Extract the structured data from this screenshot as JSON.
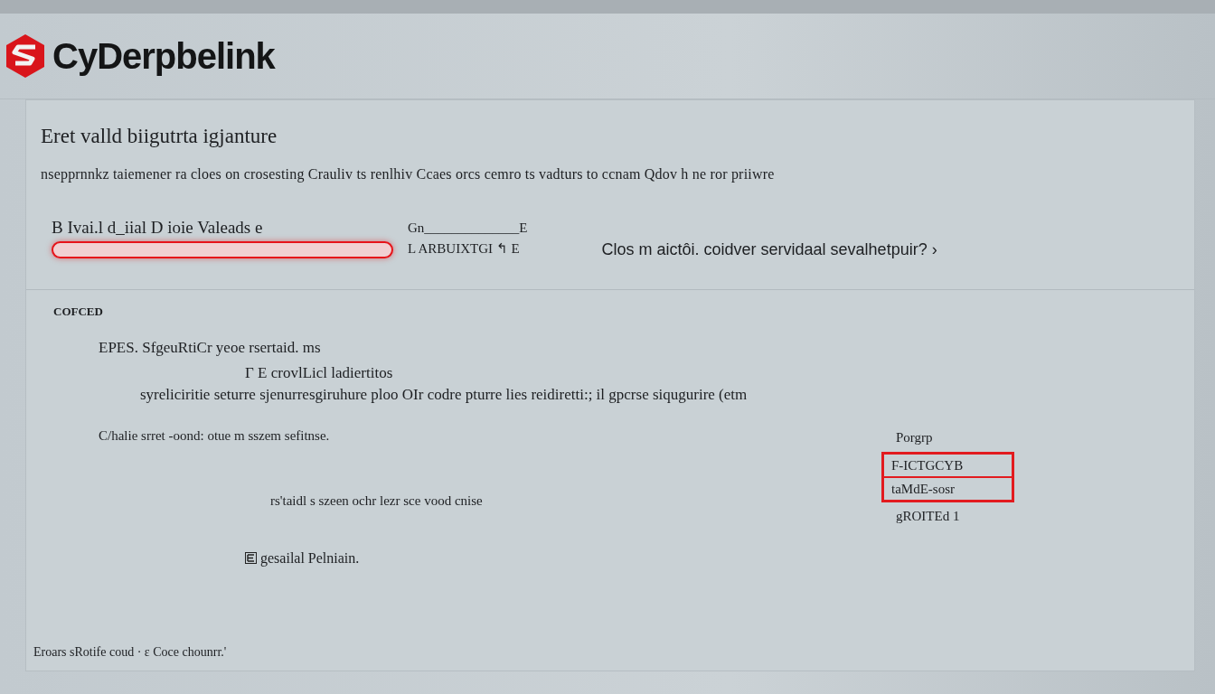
{
  "brand": {
    "name": "CyDerpbelink"
  },
  "heading": "Eret valld biigutrta igjanture",
  "description": "nsepprnnkz taiemener ra cloes on crosesting Crauliv ts renlhiv Ccaes orcs cemro ts vadturs to ccnam Qdov h ne ror priiwre",
  "field": {
    "label": "B Ivai.l d_iial D ioie Valeads e",
    "invalid": true
  },
  "side_labels": [
    "Gn______________E",
    "L ARBUIXTGI ↰ E"
  ],
  "question": "Clos m aictôi. coidver servidaal sevalhetpuir? ›",
  "section": {
    "title": "COFCED",
    "lines": [
      "EPES. SfgeuRtiCr yeoe rsertaid. ms",
      "Г E crovlLicl ladiertitos",
      "syreliciritie seturre sjenurresgiruhure ploo OIr codre pturre lies reidiretti:; il gpcrse siqugurire (etm"
    ],
    "note": "C/halie srret -oond: otue m sszem sefitnse.",
    "sub_note": "rs'taidl s szeen ochr lezr sce vood cnise",
    "checkbox": {
      "label": "gesailal Pelniain.",
      "checked": true
    },
    "picker": {
      "label": "Porgrp",
      "options": [
        {
          "label": "F-ICTGCYB",
          "selected": true
        },
        {
          "label": "taMdE-sosr",
          "selected": false
        }
      ],
      "footer": "gROITEd 1"
    }
  },
  "footer": "Eroars sRotife coud · ε Coce chounrr.'"
}
